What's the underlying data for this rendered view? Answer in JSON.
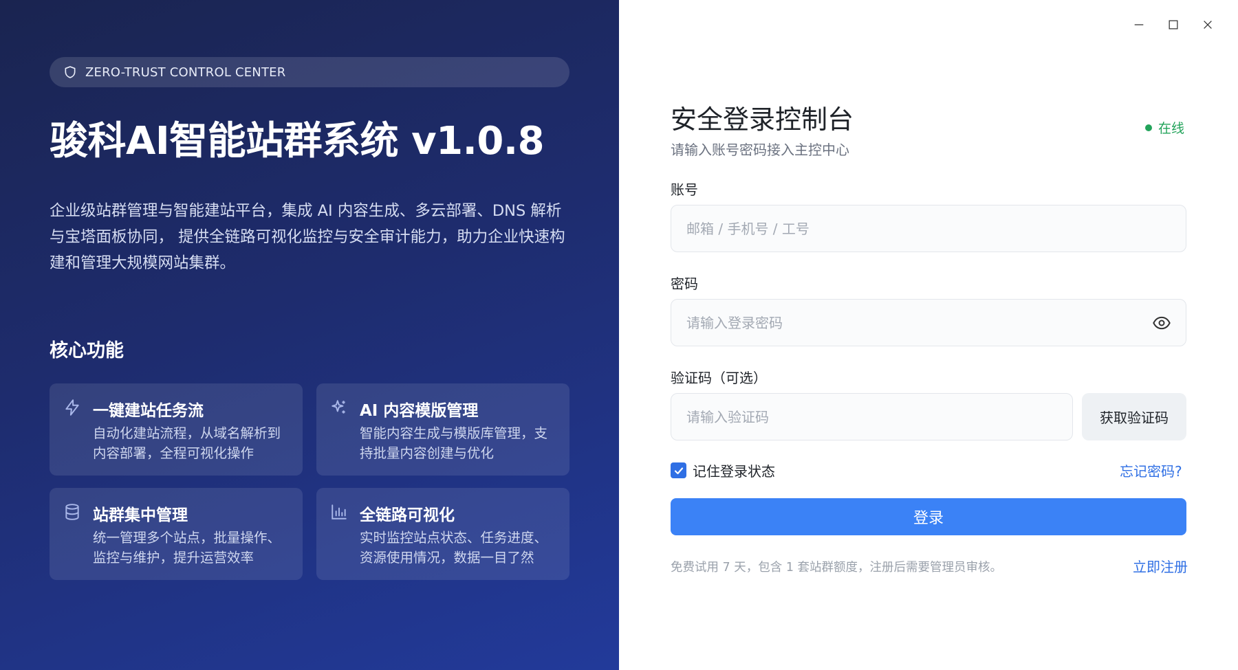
{
  "left": {
    "badge_text": "ZERO-TRUST CONTROL CENTER",
    "title": "骏科AI智能站群系统 v1.0.8",
    "description": "企业级站群管理与智能建站平台，集成 AI 内容生成、多云部署、DNS 解析与宝塔面板协同， 提供全链路可视化监控与安全审计能力，助力企业快速构建和管理大规模网站集群。",
    "features_heading": "核心功能",
    "features": [
      {
        "icon": "lightning-icon",
        "title": "一键建站任务流",
        "desc": "自动化建站流程，从域名解析到内容部署，全程可视化操作"
      },
      {
        "icon": "sparkle-icon",
        "title": "AI 内容模版管理",
        "desc": "智能内容生成与模版库管理，支持批量内容创建与优化"
      },
      {
        "icon": "database-icon",
        "title": "站群集中管理",
        "desc": "统一管理多个站点，批量操作、监控与维护，提升运营效率"
      },
      {
        "icon": "bar-chart-icon",
        "title": "全链路可视化",
        "desc": "实时监控站点状态、任务进度、资源使用情况，数据一目了然"
      }
    ]
  },
  "right": {
    "title": "安全登录控制台",
    "subtitle": "请输入账号密码接入主控中心",
    "status": "在线",
    "account_label": "账号",
    "account_placeholder": "邮箱 / 手机号 / 工号",
    "password_label": "密码",
    "password_placeholder": "请输入登录密码",
    "code_label": "验证码（可选）",
    "code_placeholder": "请输入验证码",
    "get_code_label": "获取验证码",
    "remember_label": "记住登录状态",
    "forgot_label": "忘记密码?",
    "login_label": "登录",
    "trial_text": "免费试用 7 天，包含 1 套站群额度，注册后需要管理员审核。",
    "register_label": "立即注册"
  },
  "colors": {
    "accent": "#3b82f6",
    "link": "#2f6fe4",
    "online": "#22a35a",
    "left_bg": "#1e2c6e"
  }
}
